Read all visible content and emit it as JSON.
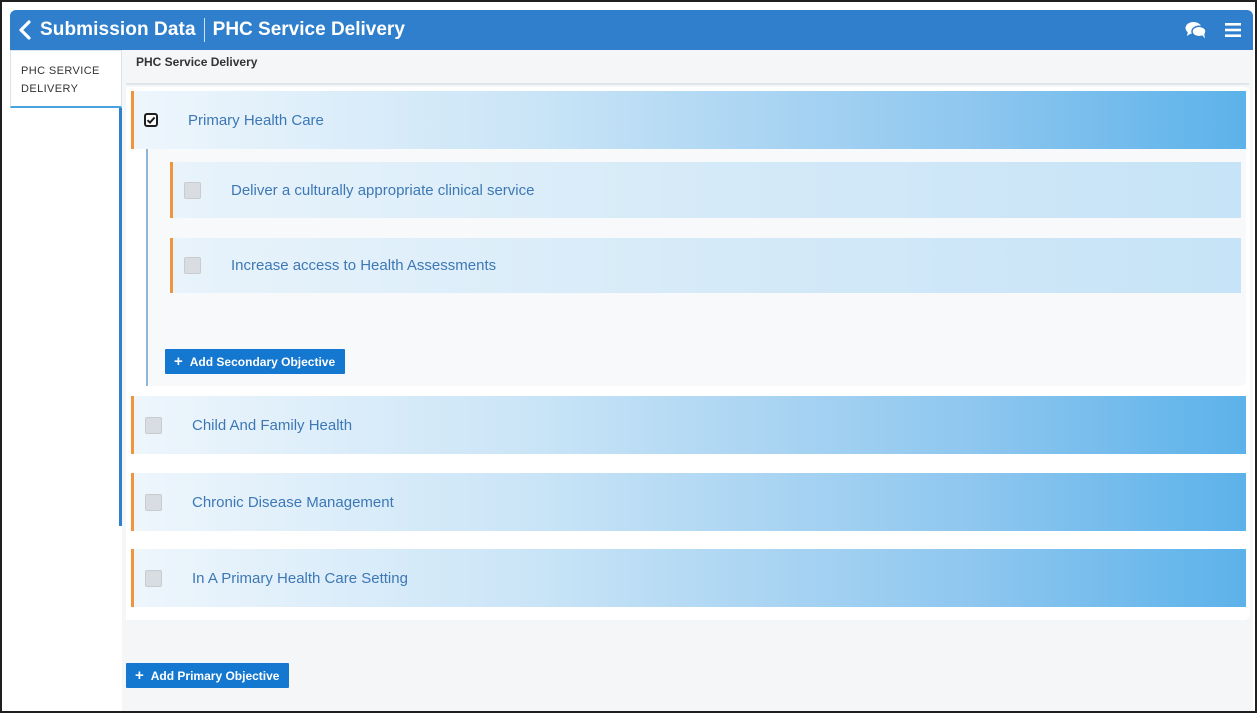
{
  "header": {
    "title": "Submission Data",
    "subtitle": "PHC Service Delivery",
    "back_icon": "chevron-left-icon",
    "chat_icon": "chat-bubbles-icon",
    "menu_icon": "hamburger-menu-icon"
  },
  "sidebar": {
    "tabs": [
      {
        "label": "PHC SERVICE DELIVERY",
        "active": true
      }
    ]
  },
  "main": {
    "section_title": "PHC Service Delivery",
    "primary_objectives": [
      {
        "label": "Primary Health Care",
        "checked": true,
        "secondary_objectives": [
          {
            "label": "Deliver a culturally appropriate clinical service",
            "checked": false
          },
          {
            "label": "Increase access to Health Assessments",
            "checked": false
          }
        ],
        "add_secondary_label": "Add Secondary Objective"
      },
      {
        "label": "Child And Family Health",
        "checked": false
      },
      {
        "label": "Chronic Disease Management",
        "checked": false
      },
      {
        "label": "In A Primary Health Care Setting",
        "checked": false
      }
    ],
    "add_primary_label": "Add Primary Objective"
  },
  "colors": {
    "header": "#2f7fcc",
    "accent_border": "#f0943e",
    "button": "#1477d0",
    "label_text": "#3d78b5"
  }
}
